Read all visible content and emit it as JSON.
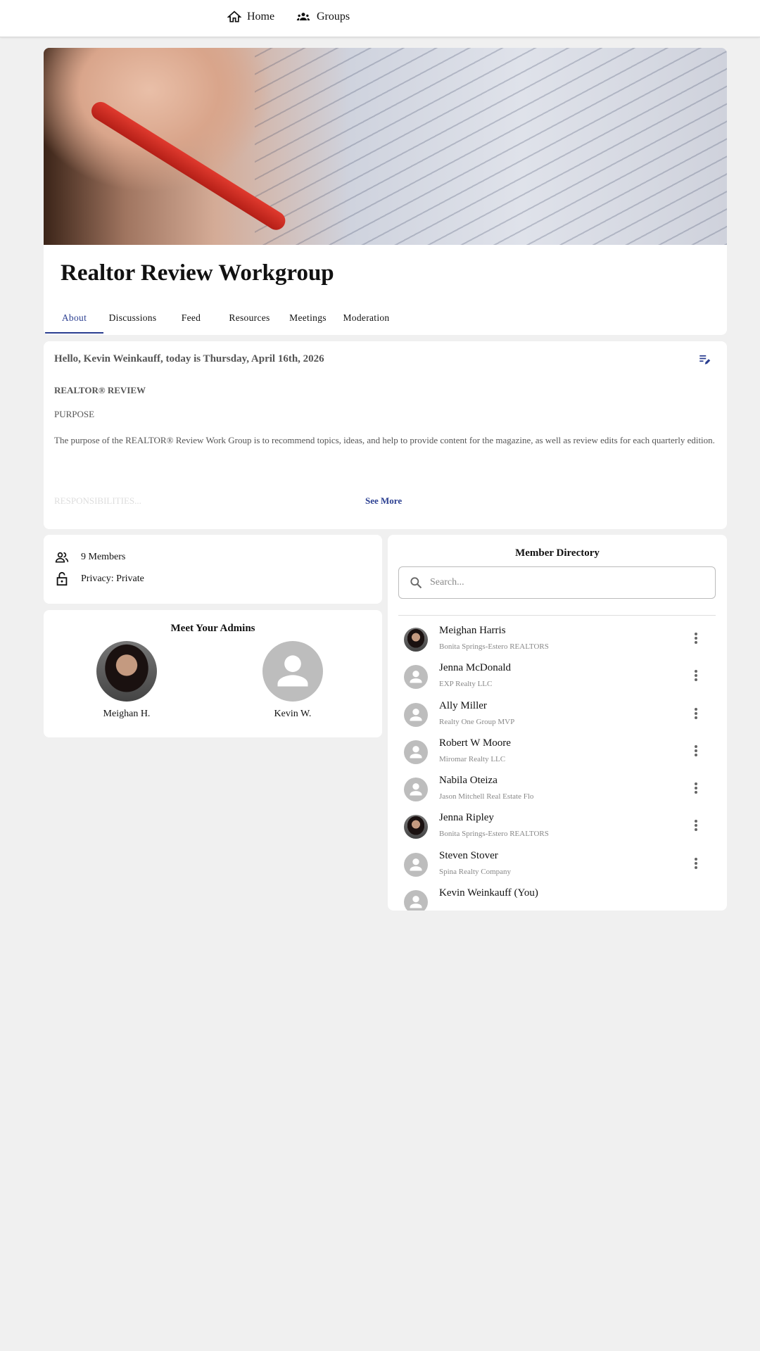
{
  "nav": {
    "home": "Home",
    "groups": "Groups"
  },
  "group": {
    "title": "Realtor Review Workgroup",
    "tabs": [
      "About",
      "Discussions",
      "Feed",
      "Resources",
      "Meetings",
      "Moderation"
    ],
    "active_tab": "About"
  },
  "about": {
    "greeting": "Hello, Kevin Weinkauff, today is Thursday, April 16th, 2026",
    "heading": "REALTOR® REVIEW",
    "purpose_label": "PURPOSE",
    "purpose_text": "The purpose of the REALTOR® Review Work Group is to recommend topics, ideas, and help to provide content for the magazine, as well as review edits for each quarterly edition.",
    "responsibilities": "RESPONSIBILITIES...",
    "see_more": "See More"
  },
  "stats": {
    "members": "9 Members",
    "privacy": "Privacy: Private"
  },
  "admins": {
    "title": "Meet Your Admins",
    "people": [
      {
        "name": "Meighan H.",
        "photo": true
      },
      {
        "name": "Kevin W.",
        "photo": false
      }
    ]
  },
  "directory": {
    "title": "Member Directory",
    "search_placeholder": "Search...",
    "members": [
      {
        "name": "Meighan Harris",
        "org": "Bonita Springs-Estero REALTORS",
        "photo": true
      },
      {
        "name": "Jenna McDonald",
        "org": "EXP Realty LLC",
        "photo": false
      },
      {
        "name": "Ally Miller",
        "org": "Realty One Group MVP",
        "photo": false
      },
      {
        "name": "Robert W Moore",
        "org": "Miromar Realty LLC",
        "photo": false
      },
      {
        "name": "Nabila Oteiza",
        "org": "Jason Mitchell Real Estate Flo",
        "photo": false
      },
      {
        "name": "Jenna Ripley",
        "org": "Bonita Springs-Estero REALTORS",
        "photo": true
      },
      {
        "name": "Steven Stover",
        "org": "Spina Realty Company",
        "photo": false
      },
      {
        "name": "Kevin Weinkauff (You)",
        "org": "",
        "photo": false
      }
    ]
  },
  "colors": {
    "accent": "#2b3f91",
    "background": "#f0f0f0",
    "avatar_placeholder": "#bdbdbd"
  }
}
